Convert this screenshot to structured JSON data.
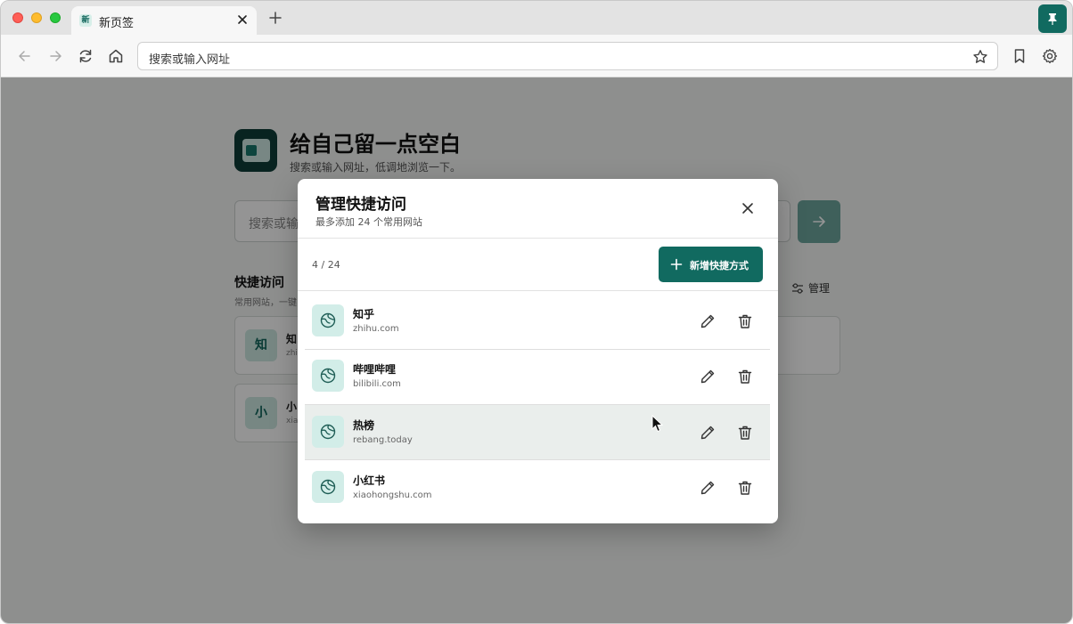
{
  "browser": {
    "tab": {
      "favicon_text": "新",
      "title": "新页签"
    },
    "address_placeholder": "搜索或输入网址"
  },
  "page": {
    "brand_title": "给自己留一点空白",
    "brand_subtitle": "搜索或输入网址，低调地浏览一下。",
    "search_placeholder": "搜索或输",
    "quick_access_title": "快捷访问",
    "quick_access_subtitle": "常用网站，一键",
    "manage_label": "管理",
    "cards": [
      {
        "badge": "知",
        "name": "知",
        "url": "zhi"
      },
      {
        "badge": "小",
        "name": "小",
        "url": "xia"
      }
    ]
  },
  "modal": {
    "title": "管理快捷访问",
    "subtitle": "最多添加 24 个常用网站",
    "count": "4 / 24",
    "add_button": "新增快捷方式",
    "items": [
      {
        "name": "知乎",
        "url": "zhihu.com"
      },
      {
        "name": "哔哩哔哩",
        "url": "bilibili.com"
      },
      {
        "name": "热榜",
        "url": "rebang.today"
      },
      {
        "name": "小红书",
        "url": "xiaohongshu.com"
      }
    ]
  },
  "colors": {
    "accent": "#116a60",
    "icon_bg": "#d2ede8",
    "hover_row": "#eaeeec"
  },
  "icons": [
    "close-icon",
    "plus-icon",
    "pin-icon",
    "back-arrow-icon",
    "forward-arrow-icon",
    "reload-icon",
    "home-icon",
    "star-icon",
    "bookmark-icon",
    "settings-icon",
    "globe-icon",
    "pencil-icon",
    "trash-icon",
    "sliders-icon",
    "arrow-right-icon"
  ]
}
